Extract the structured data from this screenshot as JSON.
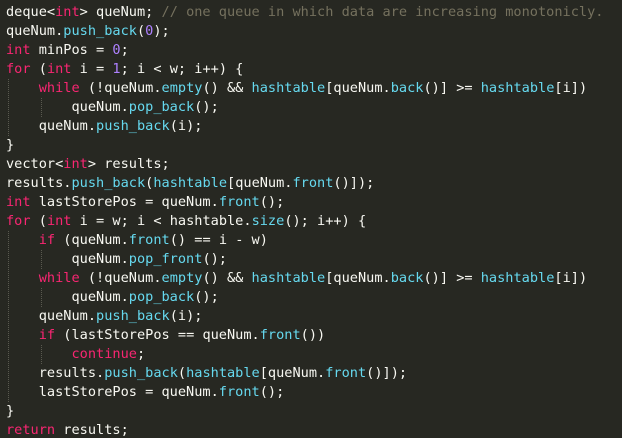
{
  "theme": {
    "background": "#272822",
    "foreground": "#f8f8f2",
    "keyword": "#f92672",
    "type": "#66d9ef",
    "function": "#66d9ef",
    "number": "#ae81ff",
    "comment": "#75715e"
  },
  "editor": {
    "lines": [
      {
        "tokens": [
          {
            "t": "deque<",
            "k": "default"
          },
          {
            "t": "int",
            "k": "keyword"
          },
          {
            "t": "> queNum; ",
            "k": "default"
          },
          {
            "t": "// one queue in which data are increasing monotonicly.",
            "k": "comment"
          }
        ]
      },
      {
        "tokens": [
          {
            "t": "queNum.",
            "k": "default"
          },
          {
            "t": "push_back",
            "k": "func"
          },
          {
            "t": "(",
            "k": "default"
          },
          {
            "t": "0",
            "k": "number"
          },
          {
            "t": ");",
            "k": "default"
          }
        ]
      },
      {
        "tokens": [
          {
            "t": "int",
            "k": "keyword"
          },
          {
            "t": " minPos = ",
            "k": "default"
          },
          {
            "t": "0",
            "k": "number"
          },
          {
            "t": ";",
            "k": "default"
          }
        ]
      },
      {
        "tokens": [
          {
            "t": "for",
            "k": "keyword"
          },
          {
            "t": " (",
            "k": "default"
          },
          {
            "t": "int",
            "k": "keyword"
          },
          {
            "t": " i = ",
            "k": "default"
          },
          {
            "t": "1",
            "k": "number"
          },
          {
            "t": "; i < w; i++) {",
            "k": "default"
          }
        ]
      },
      {
        "tokens": [
          {
            "t": "    ",
            "k": "default"
          },
          {
            "t": "while",
            "k": "keyword"
          },
          {
            "t": " (!queNum.",
            "k": "default"
          },
          {
            "t": "empty",
            "k": "func"
          },
          {
            "t": "() && ",
            "k": "default"
          },
          {
            "t": "hashtable",
            "k": "func"
          },
          {
            "t": "[queNum.",
            "k": "default"
          },
          {
            "t": "back",
            "k": "func"
          },
          {
            "t": "()] >= ",
            "k": "default"
          },
          {
            "t": "hashtable",
            "k": "func"
          },
          {
            "t": "[i])",
            "k": "default"
          }
        ]
      },
      {
        "tokens": [
          {
            "t": "        queNum.",
            "k": "default"
          },
          {
            "t": "pop_back",
            "k": "func"
          },
          {
            "t": "();",
            "k": "default"
          }
        ]
      },
      {
        "tokens": [
          {
            "t": "    queNum.",
            "k": "default"
          },
          {
            "t": "push_back",
            "k": "func"
          },
          {
            "t": "(i);",
            "k": "default"
          }
        ]
      },
      {
        "tokens": [
          {
            "t": "}",
            "k": "default"
          }
        ]
      },
      {
        "tokens": [
          {
            "t": "vector<",
            "k": "default"
          },
          {
            "t": "int",
            "k": "keyword"
          },
          {
            "t": "> results;",
            "k": "default"
          }
        ]
      },
      {
        "tokens": [
          {
            "t": "results.",
            "k": "default"
          },
          {
            "t": "push_back",
            "k": "func"
          },
          {
            "t": "(",
            "k": "default"
          },
          {
            "t": "hashtable",
            "k": "func"
          },
          {
            "t": "[queNum.",
            "k": "default"
          },
          {
            "t": "front",
            "k": "func"
          },
          {
            "t": "()]);",
            "k": "default"
          }
        ]
      },
      {
        "tokens": [
          {
            "t": "int",
            "k": "keyword"
          },
          {
            "t": " lastStorePos = queNum.",
            "k": "default"
          },
          {
            "t": "front",
            "k": "func"
          },
          {
            "t": "();",
            "k": "default"
          }
        ]
      },
      {
        "tokens": [
          {
            "t": "for",
            "k": "keyword"
          },
          {
            "t": " (",
            "k": "default"
          },
          {
            "t": "int",
            "k": "keyword"
          },
          {
            "t": " i = w; i < hashtable.",
            "k": "default"
          },
          {
            "t": "size",
            "k": "func"
          },
          {
            "t": "(); i++) {",
            "k": "default"
          }
        ]
      },
      {
        "tokens": [
          {
            "t": "    ",
            "k": "default"
          },
          {
            "t": "if",
            "k": "keyword"
          },
          {
            "t": " (queNum.",
            "k": "default"
          },
          {
            "t": "front",
            "k": "func"
          },
          {
            "t": "() == i - w)",
            "k": "default"
          }
        ]
      },
      {
        "tokens": [
          {
            "t": "        queNum.",
            "k": "default"
          },
          {
            "t": "pop_front",
            "k": "func"
          },
          {
            "t": "();",
            "k": "default"
          }
        ]
      },
      {
        "tokens": [
          {
            "t": "    ",
            "k": "default"
          },
          {
            "t": "while",
            "k": "keyword"
          },
          {
            "t": " (!queNum.",
            "k": "default"
          },
          {
            "t": "empty",
            "k": "func"
          },
          {
            "t": "() && ",
            "k": "default"
          },
          {
            "t": "hashtable",
            "k": "func"
          },
          {
            "t": "[queNum.",
            "k": "default"
          },
          {
            "t": "back",
            "k": "func"
          },
          {
            "t": "()] >= ",
            "k": "default"
          },
          {
            "t": "hashtable",
            "k": "func"
          },
          {
            "t": "[i])",
            "k": "default"
          }
        ]
      },
      {
        "tokens": [
          {
            "t": "        queNum.",
            "k": "default"
          },
          {
            "t": "pop_back",
            "k": "func"
          },
          {
            "t": "();",
            "k": "default"
          }
        ]
      },
      {
        "tokens": [
          {
            "t": "    queNum.",
            "k": "default"
          },
          {
            "t": "push_back",
            "k": "func"
          },
          {
            "t": "(i);",
            "k": "default"
          }
        ]
      },
      {
        "tokens": [
          {
            "t": "    ",
            "k": "default"
          },
          {
            "t": "if",
            "k": "keyword"
          },
          {
            "t": " (lastStorePos == queNum.",
            "k": "default"
          },
          {
            "t": "front",
            "k": "func"
          },
          {
            "t": "())",
            "k": "default"
          }
        ]
      },
      {
        "tokens": [
          {
            "t": "        ",
            "k": "default"
          },
          {
            "t": "continue",
            "k": "keyword"
          },
          {
            "t": ";",
            "k": "default"
          }
        ]
      },
      {
        "tokens": [
          {
            "t": "    results.",
            "k": "default"
          },
          {
            "t": "push_back",
            "k": "func"
          },
          {
            "t": "(",
            "k": "default"
          },
          {
            "t": "hashtable",
            "k": "func"
          },
          {
            "t": "[queNum.",
            "k": "default"
          },
          {
            "t": "front",
            "k": "func"
          },
          {
            "t": "()]);",
            "k": "default"
          }
        ]
      },
      {
        "tokens": [
          {
            "t": "    lastStorePos = queNum.",
            "k": "default"
          },
          {
            "t": "front",
            "k": "func"
          },
          {
            "t": "();",
            "k": "default"
          }
        ]
      },
      {
        "tokens": [
          {
            "t": "}",
            "k": "default"
          }
        ]
      },
      {
        "tokens": [
          {
            "t": "return",
            "k": "keyword"
          },
          {
            "t": " results;",
            "k": "default"
          }
        ]
      }
    ]
  }
}
